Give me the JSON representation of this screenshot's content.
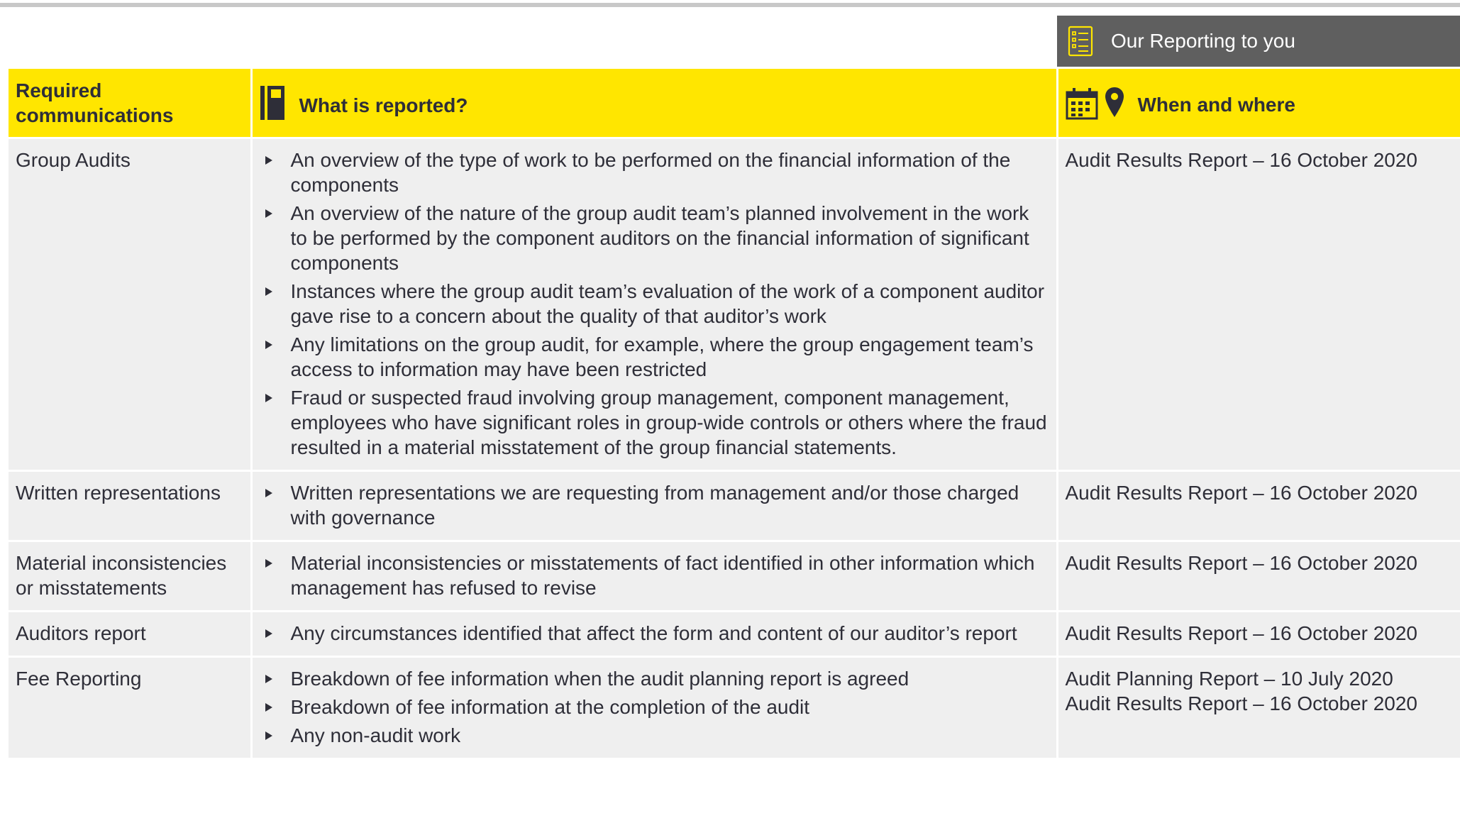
{
  "banner": {
    "label": "Our Reporting to you",
    "icon": "report-list-icon"
  },
  "headers": {
    "required": "Required communications",
    "what": "What is reported?",
    "what_icon": "book-icon",
    "when": "When and where",
    "when_icons": [
      "calendar-icon",
      "location-pin-icon"
    ]
  },
  "colors": {
    "accent_yellow": "#ffe600",
    "banner_gray": "#5f5f5f",
    "row_background": "#efefef",
    "text": "#2e2e38"
  },
  "rows": [
    {
      "name": "Group Audits",
      "items": [
        "An overview of the type of work to be performed on the financial information of the components",
        "An overview of the nature of the group audit team’s planned involvement in the work to be performed by the component auditors on the financial information of significant components",
        "Instances where the group audit team’s evaluation of the work of a component auditor gave rise to a concern about the quality of that auditor’s work",
        "Any limitations on the group audit, for example, where the group engagement team’s access to information may have been restricted",
        "Fraud or suspected fraud involving group management, component management, employees who have significant roles in group-wide controls or others where the fraud resulted in a material misstatement of the group financial statements."
      ],
      "when": [
        "Audit Results Report – 16 October 2020"
      ]
    },
    {
      "name": "Written representations",
      "items": [
        "Written representations we are requesting from management and/or those charged with governance"
      ],
      "when": [
        "Audit Results Report – 16 October 2020"
      ]
    },
    {
      "name": "Material inconsistencies or misstatements",
      "items": [
        "Material inconsistencies or misstatements of fact identified in other information which management has refused to revise"
      ],
      "when": [
        "Audit Results Report – 16 October 2020"
      ]
    },
    {
      "name": "Auditors report",
      "items": [
        "Any circumstances identified that affect the form and content of our auditor’s report"
      ],
      "when": [
        "Audit Results Report – 16 October 2020"
      ]
    },
    {
      "name": "Fee Reporting",
      "items": [
        "Breakdown of fee information when the  audit planning report is agreed",
        "Breakdown of fee information at the completion of the audit",
        "Any non-audit work"
      ],
      "when": [
        "Audit Planning Report – 10 July 2020",
        "Audit Results Report – 16 October 2020"
      ]
    }
  ]
}
